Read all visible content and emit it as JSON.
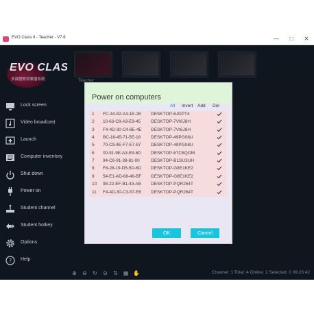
{
  "window": {
    "title": "EVO Class II - Teacher - V7.6"
  },
  "logo": {
    "name": "EVO CLASS II",
    "subtitle": "多媒體教學廣播系統"
  },
  "sidebar": {
    "items": [
      {
        "label": "Lock screen",
        "icon": "monitor-icon"
      },
      {
        "label": "Video broadcast",
        "icon": "music-video-icon"
      },
      {
        "label": "Launch",
        "icon": "launch-icon"
      },
      {
        "label": "Computer inventory",
        "icon": "inventory-icon"
      },
      {
        "label": "Shut down",
        "icon": "shutdown-icon"
      },
      {
        "label": "Power on",
        "icon": "power-plug-icon"
      },
      {
        "label": "Student channel",
        "icon": "channel-icon"
      },
      {
        "label": "Student hotkey",
        "icon": "hotkey-icon"
      },
      {
        "label": "Options",
        "icon": "gear-icon"
      },
      {
        "label": "Help",
        "icon": "help-icon"
      }
    ]
  },
  "thumbnails": {
    "teacher_label": "Teacher"
  },
  "dialog": {
    "title": "Power on computers",
    "col_all": "All",
    "col_invert": "Invert",
    "col_add": "Add",
    "col_del": "Del",
    "rows": [
      {
        "num": "1",
        "mac": "FC-44-82-A4-1E-2E",
        "host": "DESKTOP-6JDPT4"
      },
      {
        "num": "2",
        "mac": "10-63-C8-A3-E9-45",
        "host": "DESKTOP-7VI6J8H"
      },
      {
        "num": "3",
        "mac": "F4-4D-30-C4-6E-4E",
        "host": "DESKTOP-7VI6J8H"
      },
      {
        "num": "4",
        "mac": "BC-16-45-71-5E-18",
        "host": "DESKTOP-49PG08U"
      },
      {
        "num": "5",
        "mac": "70-C9-4E-F7-E7-67",
        "host": "DESKTOP-49PG08U"
      },
      {
        "num": "6",
        "mac": "00-91-9E-A3-E9-6D",
        "host": "DESKTOP-67C6QOM"
      },
      {
        "num": "7",
        "mac": "94-C6-91-38-81-00",
        "host": "DESKTOP-B1SU3UH"
      },
      {
        "num": "8",
        "mac": "F8-28-19-D5-5D-6D",
        "host": "DESKTOP-G8E1KE2"
      },
      {
        "num": "9",
        "mac": "54-E1-AD-68-46-BF",
        "host": "DESKTOP-G8E1KE2"
      },
      {
        "num": "10",
        "mac": "98-22-EF-B1-43-AB",
        "host": "DESKTOP-PQR264T"
      },
      {
        "num": "11",
        "mac": "F4-4D-30-C3-57-E6",
        "host": "DESKTOP-PQR264T"
      }
    ],
    "ok_label": "OK",
    "cancel_label": "Cancel"
  },
  "statusbar": {
    "text": "Channel: 1   Total: 4   Online: 1   Selected: 0   09:23:42"
  },
  "colors": {
    "accent": "#18c5de",
    "dialog_header": "#dff5d9",
    "row_highlight": "#f6dcdc",
    "link": "#2a7de0"
  }
}
